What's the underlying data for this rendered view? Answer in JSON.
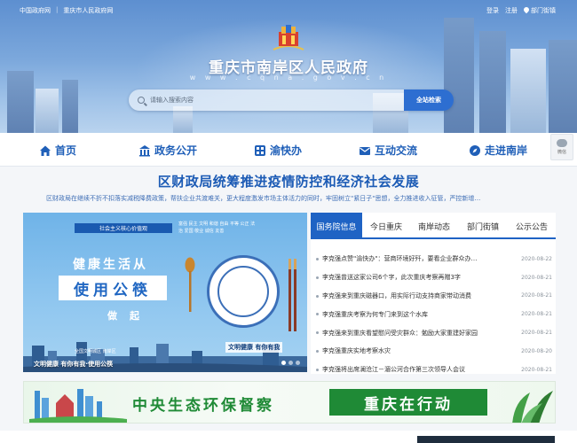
{
  "topbar": {
    "left_links": [
      "中国政府网",
      "重庆市人民政府网"
    ],
    "login": "登录",
    "register": "注册",
    "dept_street": "部门街镇"
  },
  "site": {
    "title": "重庆市南岸区人民政府",
    "url": "w w w . c q n a . g o v . c n"
  },
  "search": {
    "placeholder": "请输入搜索内容",
    "button": "全站检索"
  },
  "nav": [
    {
      "label": "首页",
      "icon": "home-icon"
    },
    {
      "label": "政务公开",
      "icon": "government-building-icon"
    },
    {
      "label": "渝快办",
      "icon": "service-grid-icon"
    },
    {
      "label": "互动交流",
      "icon": "mailbox-icon"
    },
    {
      "label": "走进南岸",
      "icon": "compass-icon"
    }
  ],
  "wechat": {
    "label": "微信"
  },
  "headline": {
    "title": "区财政局统筹推进疫情防控和经济社会发展",
    "summary": "区财政局在继续不折不扣落实减税降费政策，帮扶企业共渡难关，更大程度激发市场主体活力的同时，牢固树立\"紧日子\"思想，全力推进收入征管，严控新增…"
  },
  "promo": {
    "top_strip": "社会主义核心价值观",
    "slogan": "富强 民主 文明 和谐 自由 平等 公正 法治 爱国 敬业 诚信 友善",
    "line1": "健康生活从",
    "line2": "使用公筷",
    "line3": "做起",
    "caption": "文明健康 有你有我·使用公筷",
    "badge": "文明健康 有你有我",
    "mini_logo": "全国文明城区 南岸区"
  },
  "news": {
    "tabs": [
      "国务院信息",
      "今日重庆",
      "南岸动态",
      "部门街镇",
      "公示公告"
    ],
    "active_tab": 0,
    "items": [
      {
        "title": "李克强点赞\"渝快办\"：营商环境好歼，要看企业群众办…",
        "date": "2020-08-22"
      },
      {
        "title": "李克强曾送这家公司6个字，此次重庆考察再赠3字",
        "date": "2020-08-21"
      },
      {
        "title": "李克强来到重庆磁器口，用实际行动支持商家带动消费",
        "date": "2020-08-21"
      },
      {
        "title": "李克强重庆考察为何专门来到这个水库",
        "date": "2020-08-21"
      },
      {
        "title": "李克强来到重庆看望慰问受灾群众：勉励大家重建好家园",
        "date": "2020-08-21"
      },
      {
        "title": "李克强重庆实地考察水灾",
        "date": "2020-08-20"
      },
      {
        "title": "李克强将出席澜沧江－湄公河合作第三次领导人会议",
        "date": "2020-08-21"
      }
    ]
  },
  "eco_banner": {
    "left": "中央生态环保督察",
    "right": "重庆在行动"
  },
  "colors": {
    "brand_blue": "#1f63c4",
    "eco_green": "#1f8a36"
  }
}
